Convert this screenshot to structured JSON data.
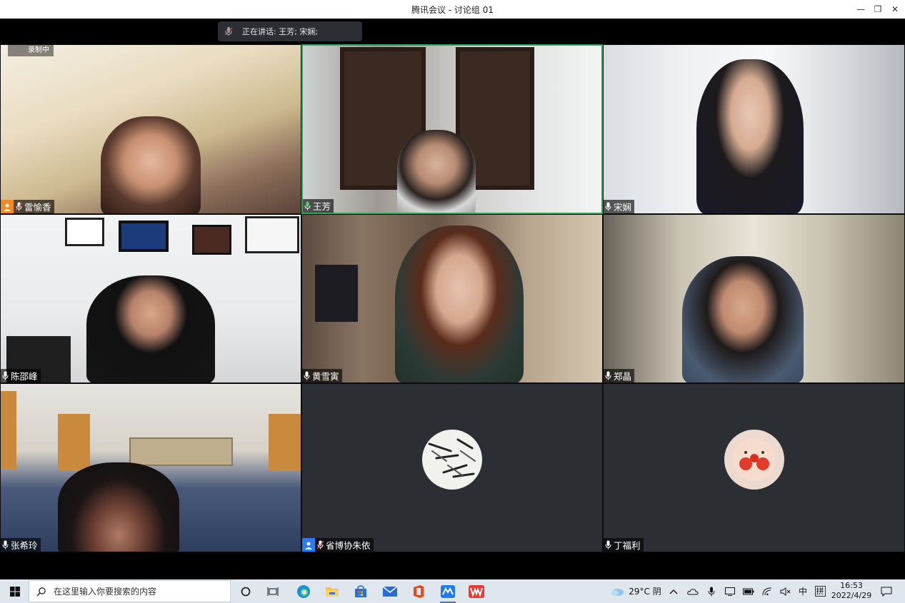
{
  "window": {
    "title": "腾讯会议 - 讨论组 01",
    "minimize": "—",
    "restore": "❐",
    "close": "✕"
  },
  "banner": {
    "speaking_text": "正在讲话: 王芳; 宋娴;"
  },
  "recording_label": "录制中",
  "participants": [
    {
      "name": "雷愉香",
      "host": true
    },
    {
      "name": "王芳",
      "speaking": true
    },
    {
      "name": "宋娴"
    },
    {
      "name": "陈邵峰"
    },
    {
      "name": "黄雪寅"
    },
    {
      "name": "郑晶"
    },
    {
      "name": "张希玲"
    },
    {
      "name": "省博协朱依",
      "video_off": true,
      "cohost": true
    },
    {
      "name": "丁福利",
      "video_off": true
    }
  ],
  "taskbar": {
    "search_placeholder": "在这里输入你要搜索的内容",
    "weather": "29°C 阴",
    "ime_lang": "中",
    "ime_mode": "拼",
    "time": "16:53",
    "date": "2022/4/29"
  },
  "colors": {
    "active_border": "#2fa356",
    "host_badge": "#f08a24",
    "cohost_badge": "#2a7cf0",
    "tile_off": "#2b2e32"
  }
}
